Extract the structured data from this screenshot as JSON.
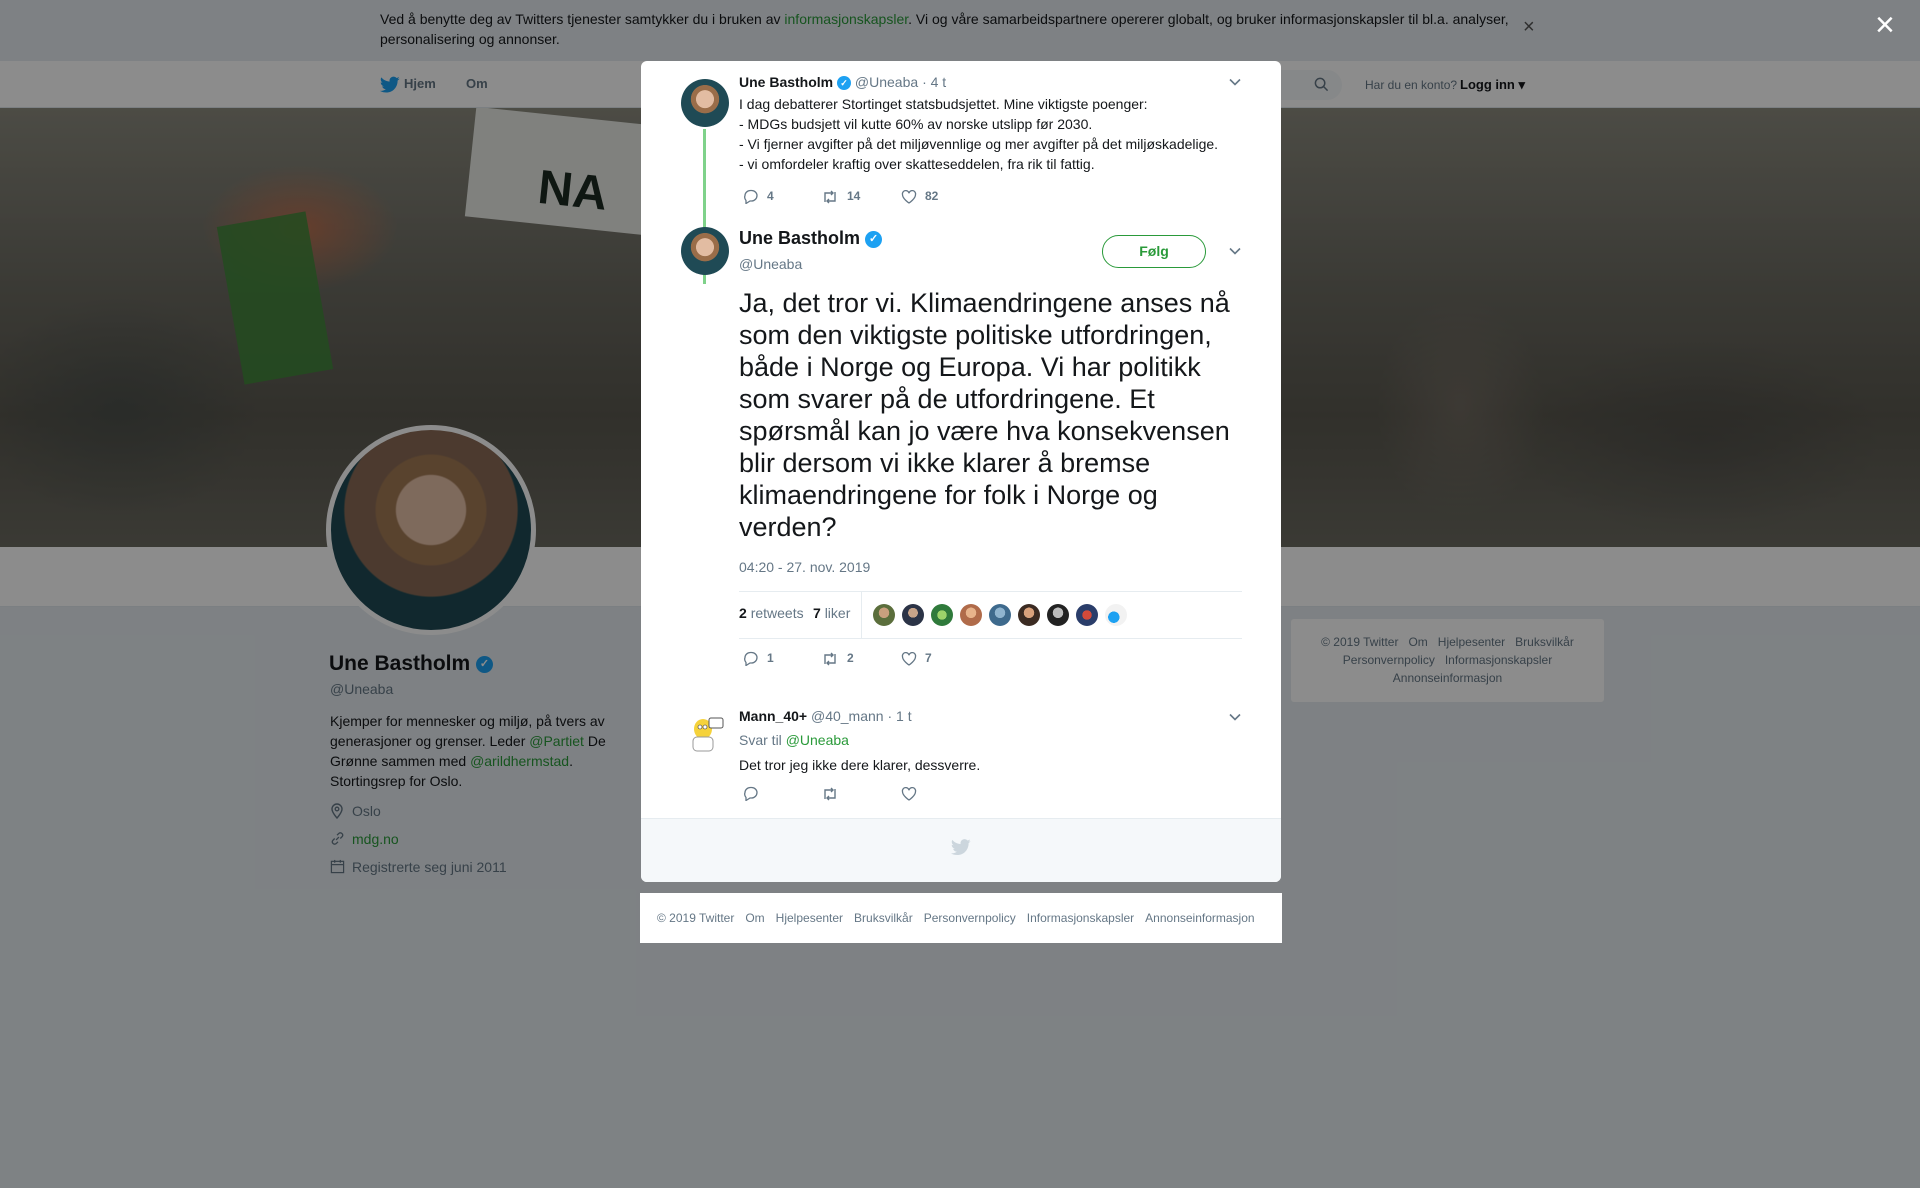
{
  "cookie": {
    "text_before": "Ved å benytte deg av Twitters tjenester samtykker du i bruken av ",
    "link": "informasjonskapsler",
    "text_after": ". Vi og våre samarbeidspartnere opererer globalt, og bruker informasjonskapsler til bl.a. analyser, personalisering og annonser.",
    "close": "×"
  },
  "nav": {
    "home": "Hjem",
    "about": "Om",
    "login_question": "Har du en konto?",
    "login": "Logg inn"
  },
  "profile": {
    "name": "Une Bastholm",
    "handle": "@Uneaba",
    "bio_1": "Kjemper for mennesker og miljø, på tvers av generasjoner og grenser. Leder ",
    "bio_link1": "@Partiet",
    "bio_2": " De Grønne sammen med ",
    "bio_link2": "@arildhermstad",
    "bio_3": ". Stortingsrep for Oslo.",
    "location": "Oslo",
    "website": "mdg.no",
    "joined": "Registrerte seg juni 2011"
  },
  "side_footer": [
    "© 2019 Twitter",
    "Om",
    "Hjelpesenter",
    "Bruksvilkår",
    "Personvernpolicy",
    "Informasjonskapsler",
    "Annonseinformasjon"
  ],
  "overlay_close": "×",
  "parent_tweet": {
    "name": "Une Bastholm",
    "handle": "@Uneaba",
    "time": "· 4 t",
    "lines": [
      "I dag debatterer Stortinget statsbudsjettet. Mine viktigste poenger:",
      "- MDGs budsjett vil kutte 60% av norske utslipp før 2030.",
      "- Vi fjerner avgifter på det miljøvennlige og mer avgifter på det miljøskadelige.",
      "- vi omfordeler kraftig over skatteseddelen, fra rik til fattig."
    ],
    "replies": "4",
    "retweets": "14",
    "likes": "82"
  },
  "main_tweet": {
    "name": "Une Bastholm",
    "handle": "@Uneaba",
    "follow": "Følg",
    "text": "Ja, det tror vi. Klimaendringene anses nå som den viktigste politiske utfordringen, både i Norge og Europa. Vi har politikk som svarer på de utfordringene. Et spørsmål kan jo være hva konsekvensen blir dersom vi ikke klarer å bremse klimaendringene for folk i Norge og verden?",
    "timestamp": "04:20 - 27. nov. 2019",
    "retweet_count": "2",
    "retweet_label": "retweets",
    "like_count": "7",
    "like_label": "liker",
    "replies": "1",
    "retweets": "2",
    "likes": "7"
  },
  "reply_tweet": {
    "name": "Mann_40+",
    "handle": "@40_mann",
    "time": "· 1 t",
    "reply_to_label": "Svar til",
    "reply_to": "@Uneaba",
    "text": "Det tror jeg ikke dere klarer, dessverre."
  },
  "modal_footer": [
    "© 2019 Twitter",
    "Om",
    "Hjelpesenter",
    "Bruksvilkår",
    "Personvernpolicy",
    "Informasjonskapsler",
    "Annonseinformasjon"
  ],
  "colors": {
    "accent": "#2a9a3a",
    "verified": "#1da1f2",
    "muted": "#657786"
  }
}
